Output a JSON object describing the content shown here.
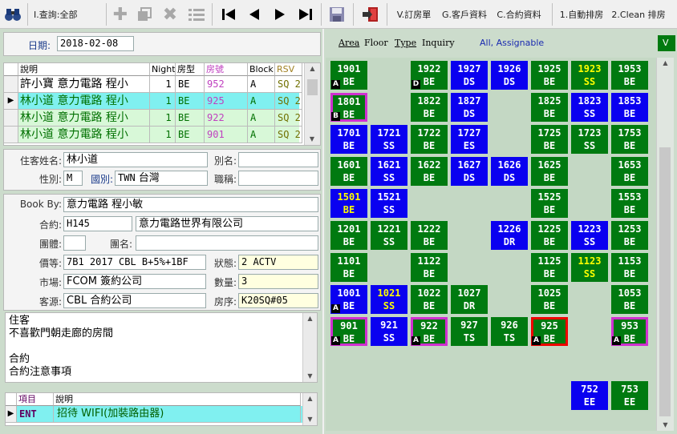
{
  "toolbar": {
    "query_label": "I.查詢:全部",
    "items": [
      "V.訂房單",
      "G.客戶資料",
      "C.合約資料",
      "1.自動排房",
      "2.Clean 排房"
    ]
  },
  "date_label": "日期:",
  "date_value": "2018-02-08",
  "grid": {
    "headers": [
      "說明",
      "Night",
      "房型",
      "房號",
      "Block",
      "RSV"
    ],
    "rows": [
      {
        "desc": "許小寶 意力電路 程小",
        "night": "1",
        "type": "BE",
        "room": "952",
        "block": "A",
        "rsv": "SQ 2"
      },
      {
        "desc": "林小道 意力電路 程小",
        "night": "1",
        "type": "BE",
        "room": "925",
        "block": "A",
        "rsv": "SQ 2"
      },
      {
        "desc": "林小道 意力電路 程小",
        "night": "1",
        "type": "BE",
        "room": "922",
        "block": "A",
        "rsv": "SQ 2"
      },
      {
        "desc": "林小道 意力電路 程小",
        "night": "1",
        "type": "BE",
        "room": "901",
        "block": "A",
        "rsv": "SQ 2"
      }
    ]
  },
  "guest": {
    "name_label": "住客姓名:",
    "name": "林小道",
    "alias_label": "別名:",
    "alias": "",
    "gender_label": "性別:",
    "gender": "M",
    "country_label": "國別:",
    "country_code": "TWN",
    "country": "台灣",
    "title_label": "職稱:",
    "title": ""
  },
  "booking": {
    "bookby_label": "Book By:",
    "bookby": "意力電路 程小敏",
    "contract_label": "合約:",
    "contract_code": "H145",
    "contract_name": "意力電路世界有限公司",
    "group_label": "團體:",
    "group": "",
    "groupname_label": "團名:",
    "groupname": "",
    "price_label": "價等:",
    "price": "7B1 2017 CBL B+5%+1BF",
    "status_label": "狀態:",
    "status": "2 ACTV",
    "market_label": "市場:",
    "market": "FCOM 簽約公司",
    "qty_label": "數量:",
    "qty": "3",
    "source_label": "客源:",
    "source": "CBL 合約公司",
    "roomkey_label": "房序:",
    "roomkey": "K20SQ#05"
  },
  "memo": [
    "住客",
    "不喜歡門朝走廊的房間",
    "",
    "合約",
    "合約注意事項"
  ],
  "bottom_grid": {
    "headers": [
      "項目",
      "說明"
    ],
    "row": {
      "code": "ENT",
      "desc": "招待 WIFI(加裝路由器)"
    }
  },
  "right_header": {
    "tabs": [
      "Area",
      "Floor",
      "Type",
      "Inquiry"
    ],
    "filter": "All, Assignable",
    "tag": "V"
  },
  "colors": {
    "green": "#007a10",
    "blue": "#0a00f0",
    "magenta": "#d030d0",
    "red": "#ee0000",
    "yellow": "#ffff00"
  },
  "rooms": [
    {
      "num": "1901",
      "type": "BE",
      "color": "green",
      "col": 0,
      "row": 0,
      "badge": "A"
    },
    {
      "num": "1922",
      "type": "BE",
      "color": "green",
      "col": 2,
      "row": 0,
      "badge": "D"
    },
    {
      "num": "1927",
      "type": "DS",
      "color": "blue",
      "col": 3,
      "row": 0
    },
    {
      "num": "1926",
      "type": "DS",
      "color": "blue",
      "col": 4,
      "row": 0
    },
    {
      "num": "1925",
      "type": "BE",
      "color": "green",
      "col": 5,
      "row": 0
    },
    {
      "num": "1923",
      "type": "SS",
      "color": "green",
      "col": 6,
      "row": 0,
      "yellow": true
    },
    {
      "num": "1953",
      "type": "BE",
      "color": "green",
      "col": 7,
      "row": 0
    },
    {
      "num": "1801",
      "type": "BE",
      "color": "green",
      "col": 0,
      "row": 1,
      "badge": "B",
      "border": "magenta"
    },
    {
      "num": "1822",
      "type": "BE",
      "color": "green",
      "col": 2,
      "row": 1
    },
    {
      "num": "1827",
      "type": "DS",
      "color": "blue",
      "col": 3,
      "row": 1
    },
    {
      "num": "1825",
      "type": "BE",
      "color": "green",
      "col": 5,
      "row": 1
    },
    {
      "num": "1823",
      "type": "SS",
      "color": "blue",
      "col": 6,
      "row": 1
    },
    {
      "num": "1853",
      "type": "BE",
      "color": "blue",
      "col": 7,
      "row": 1
    },
    {
      "num": "1701",
      "type": "BE",
      "color": "blue",
      "col": 0,
      "row": 2
    },
    {
      "num": "1721",
      "type": "SS",
      "color": "blue",
      "col": 1,
      "row": 2
    },
    {
      "num": "1722",
      "type": "BE",
      "color": "green",
      "col": 2,
      "row": 2
    },
    {
      "num": "1727",
      "type": "ES",
      "color": "blue",
      "col": 3,
      "row": 2
    },
    {
      "num": "1725",
      "type": "BE",
      "color": "green",
      "col": 5,
      "row": 2
    },
    {
      "num": "1723",
      "type": "SS",
      "color": "green",
      "col": 6,
      "row": 2
    },
    {
      "num": "1753",
      "type": "BE",
      "color": "green",
      "col": 7,
      "row": 2
    },
    {
      "num": "1601",
      "type": "BE",
      "color": "green",
      "col": 0,
      "row": 3
    },
    {
      "num": "1621",
      "type": "SS",
      "color": "blue",
      "col": 1,
      "row": 3
    },
    {
      "num": "1622",
      "type": "BE",
      "color": "green",
      "col": 2,
      "row": 3
    },
    {
      "num": "1627",
      "type": "DS",
      "color": "blue",
      "col": 3,
      "row": 3
    },
    {
      "num": "1626",
      "type": "DS",
      "color": "blue",
      "col": 4,
      "row": 3
    },
    {
      "num": "1625",
      "type": "BE",
      "color": "green",
      "col": 5,
      "row": 3
    },
    {
      "num": "1653",
      "type": "BE",
      "color": "green",
      "col": 7,
      "row": 3
    },
    {
      "num": "1501",
      "type": "BE",
      "color": "blue",
      "col": 0,
      "row": 4,
      "yellow": true
    },
    {
      "num": "1521",
      "type": "SS",
      "color": "blue",
      "col": 1,
      "row": 4
    },
    {
      "num": "1525",
      "type": "BE",
      "color": "green",
      "col": 5,
      "row": 4
    },
    {
      "num": "1553",
      "type": "BE",
      "color": "green",
      "col": 7,
      "row": 4
    },
    {
      "num": "1201",
      "type": "BE",
      "color": "green",
      "col": 0,
      "row": 5
    },
    {
      "num": "1221",
      "type": "SS",
      "color": "green",
      "col": 1,
      "row": 5
    },
    {
      "num": "1222",
      "type": "BE",
      "color": "green",
      "col": 2,
      "row": 5
    },
    {
      "num": "1226",
      "type": "DR",
      "color": "blue",
      "col": 4,
      "row": 5
    },
    {
      "num": "1225",
      "type": "BE",
      "color": "green",
      "col": 5,
      "row": 5
    },
    {
      "num": "1223",
      "type": "SS",
      "color": "blue",
      "col": 6,
      "row": 5
    },
    {
      "num": "1253",
      "type": "BE",
      "color": "green",
      "col": 7,
      "row": 5
    },
    {
      "num": "1101",
      "type": "BE",
      "color": "green",
      "col": 0,
      "row": 6
    },
    {
      "num": "1122",
      "type": "BE",
      "color": "green",
      "col": 2,
      "row": 6
    },
    {
      "num": "1125",
      "type": "BE",
      "color": "green",
      "col": 5,
      "row": 6
    },
    {
      "num": "1123",
      "type": "SS",
      "color": "green",
      "col": 6,
      "row": 6,
      "yellow": true
    },
    {
      "num": "1153",
      "type": "BE",
      "color": "green",
      "col": 7,
      "row": 6
    },
    {
      "num": "1001",
      "type": "BE",
      "color": "blue",
      "col": 0,
      "row": 7,
      "badge": "A"
    },
    {
      "num": "1021",
      "type": "SS",
      "color": "blue",
      "col": 1,
      "row": 7,
      "yellow": true
    },
    {
      "num": "1022",
      "type": "BE",
      "color": "green",
      "col": 2,
      "row": 7
    },
    {
      "num": "1027",
      "type": "DR",
      "color": "green",
      "col": 3,
      "row": 7
    },
    {
      "num": "1025",
      "type": "BE",
      "color": "green",
      "col": 5,
      "row": 7
    },
    {
      "num": "1053",
      "type": "BE",
      "color": "green",
      "col": 7,
      "row": 7
    },
    {
      "num": "901",
      "type": "BE",
      "color": "green",
      "col": 0,
      "row": 8,
      "badge": "A",
      "border": "magenta"
    },
    {
      "num": "921",
      "type": "SS",
      "color": "blue",
      "col": 1,
      "row": 8
    },
    {
      "num": "922",
      "type": "BE",
      "color": "green",
      "col": 2,
      "row": 8,
      "badge": "A",
      "border": "magenta"
    },
    {
      "num": "927",
      "type": "TS",
      "color": "green",
      "col": 3,
      "row": 8
    },
    {
      "num": "926",
      "type": "TS",
      "color": "green",
      "col": 4,
      "row": 8
    },
    {
      "num": "925",
      "type": "BE",
      "color": "green",
      "col": 5,
      "row": 8,
      "badge": "A",
      "border": "red"
    },
    {
      "num": "953",
      "type": "BE",
      "color": "green",
      "col": 7,
      "row": 8,
      "badge": "A",
      "border": "magenta"
    },
    {
      "num": "752",
      "type": "EE",
      "color": "blue",
      "col": 6,
      "row": 10
    },
    {
      "num": "753",
      "type": "EE",
      "color": "green",
      "col": 7,
      "row": 10
    }
  ]
}
